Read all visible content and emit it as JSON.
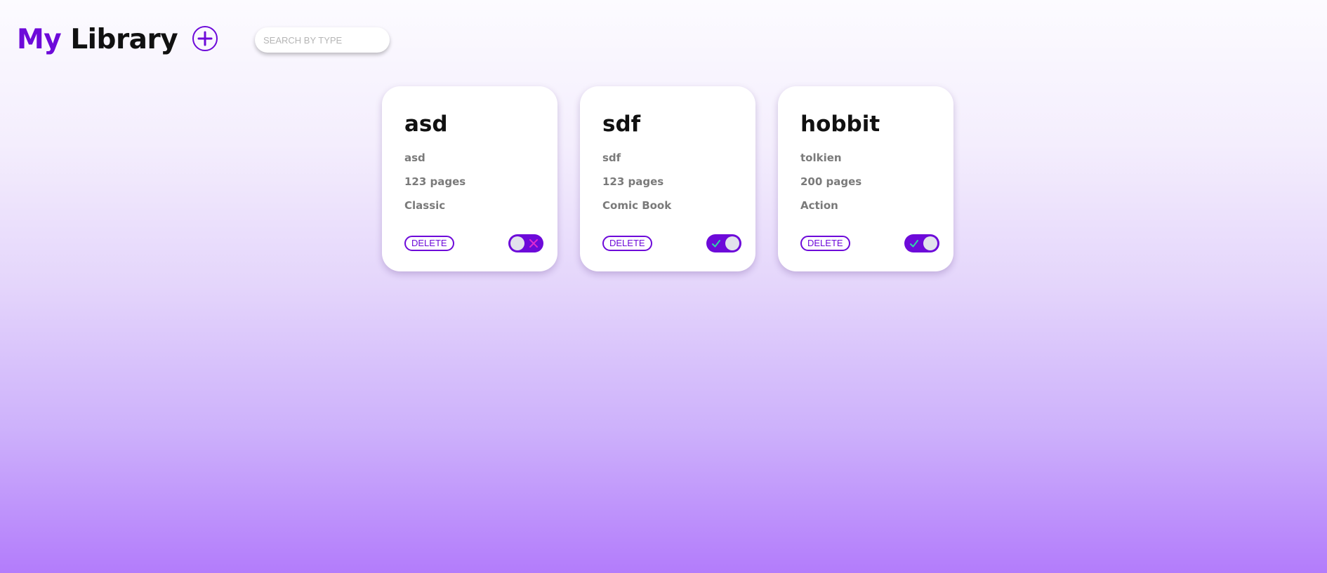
{
  "header": {
    "title_my": "My",
    "title_library": "Library",
    "add_icon": "plus-circle-icon",
    "search_placeholder": "SEARCH BY TYPE"
  },
  "colors": {
    "accent": "#6d0ad9",
    "toggle_off_icon": "#e02bd0",
    "toggle_on_icon": "#2fd6a8",
    "gradient_bottom": "#b37cfb"
  },
  "books": [
    {
      "title": "asd",
      "author": "asd",
      "pages": "123 pages",
      "genre": "Classic",
      "delete_label": "DELETE",
      "read": false,
      "toggle_icon": "close-icon"
    },
    {
      "title": "sdf",
      "author": "sdf",
      "pages": "123 pages",
      "genre": "Comic Book",
      "delete_label": "DELETE",
      "read": true,
      "toggle_icon": "check-icon"
    },
    {
      "title": "hobbit",
      "author": "tolkien",
      "pages": "200 pages",
      "genre": "Action",
      "delete_label": "DELETE",
      "read": true,
      "toggle_icon": "check-icon"
    }
  ]
}
